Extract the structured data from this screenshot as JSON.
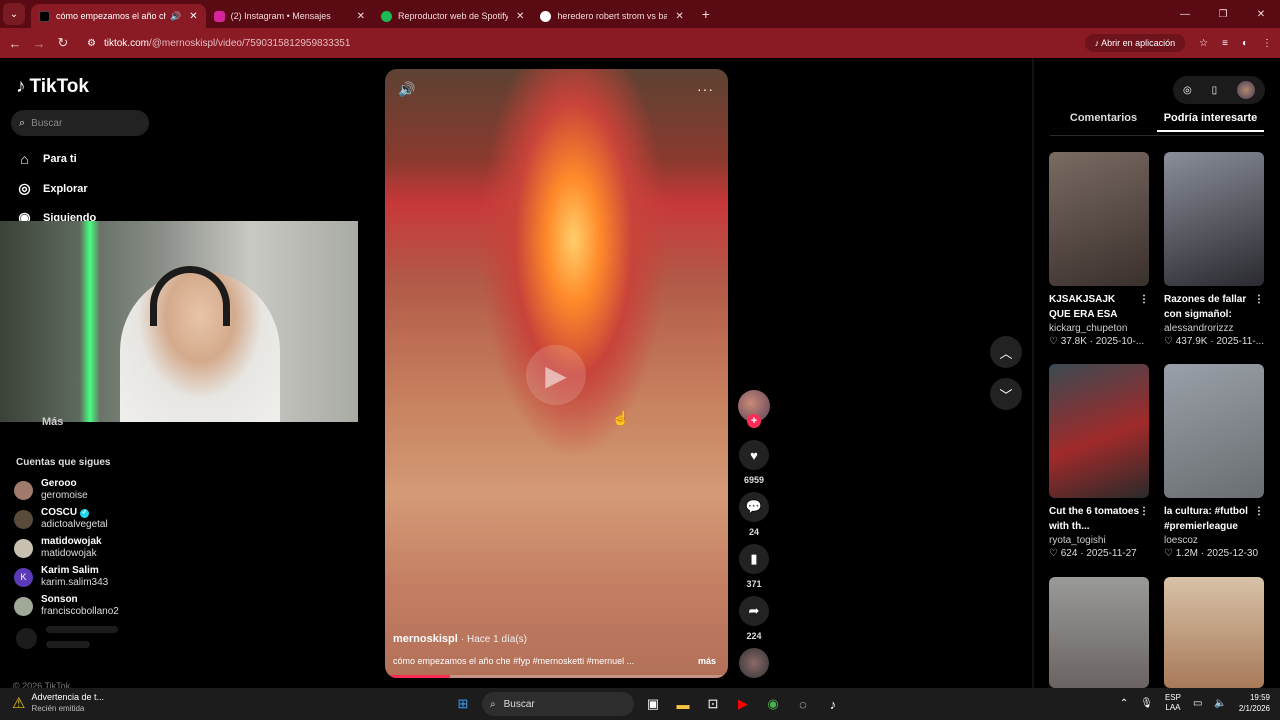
{
  "browser": {
    "tabs": [
      {
        "title": "cómo empezamos el año che",
        "color": "#000000"
      },
      {
        "title": "(2) Instagram • Mensajes",
        "color": "#d6249f"
      },
      {
        "title": "Reproductor web de Spotify: m",
        "color": "#1db954"
      },
      {
        "title": "heredero robert strom vs baule",
        "color": "#4285f4"
      }
    ],
    "url_domain": "tiktok.com",
    "url_path": "/@mernoskispl/video/7590315812959833351",
    "open_in_app": "Abrir en aplicación"
  },
  "sidebar": {
    "logo": "TikTok",
    "search_placeholder": "Buscar",
    "nav": [
      {
        "label": "Para ti",
        "icon": "home-icon"
      },
      {
        "label": "Explorar",
        "icon": "compass-icon"
      },
      {
        "label": "Siguiendo",
        "icon": "following-icon"
      }
    ],
    "more_label": "Más",
    "following_title": "Cuentas que sigues",
    "following": [
      {
        "name": "Gerooo",
        "handle": "geromoise",
        "verified": false,
        "initial": ""
      },
      {
        "name": "COSCU",
        "handle": "adictoalvegetal",
        "verified": true,
        "initial": ""
      },
      {
        "name": "matidowojak",
        "handle": "matidowojak",
        "verified": false,
        "initial": ""
      },
      {
        "name": "Karim Salim",
        "handle": "karim.salim343",
        "verified": false,
        "initial": "K"
      },
      {
        "name": "Sonson",
        "handle": "franciscobollano2",
        "verified": false,
        "initial": ""
      }
    ],
    "copyright": "© 2026 TikTok"
  },
  "video": {
    "author": "mernoskispl",
    "time": "· Hace 1 día(s)",
    "caption": "cómo empezamos el año che #fyp #mernosketti #mernuel ...",
    "more": "más",
    "progress": 0.19,
    "likes": "6959",
    "comments": "24",
    "saves": "371",
    "shares": "224"
  },
  "right_panel": {
    "tabs": [
      {
        "label": "Comentarios",
        "active": false
      },
      {
        "label": "Podría interesarte",
        "active": true
      }
    ],
    "cards": [
      {
        "title": "KJSAKJSAJK QUE ERA ESA LEEETR...",
        "user": "kickarg_chupeton",
        "likes": "37.8K",
        "date": "2025-10-...",
        "thumb": "#6a5a52"
      },
      {
        "title": "Razones de fallar con sigmañol:",
        "user": "alessandrorizzz",
        "likes": "437.9K",
        "date": "2025-11-...",
        "thumb": "#4a4a52"
      },
      {
        "title": "Cut the 6 tomatoes with th...",
        "user": "ryota_togishi",
        "likes": "624",
        "date": "2025-11-27",
        "thumb": "#5a3a3a"
      },
      {
        "title": "la cultura: #futbol #premierleague",
        "user": "loescoz",
        "likes": "1.2M",
        "date": "2025-12-30",
        "thumb": "#6a7078"
      },
      {
        "title": "",
        "user": "",
        "likes": "",
        "date": "",
        "thumb": "#8a8a88"
      },
      {
        "title": "",
        "user": "",
        "likes": "",
        "date": "",
        "thumb": "#b89a82"
      }
    ]
  },
  "taskbar": {
    "notification_title": "Advertencia de t...",
    "notification_sub": "Recién emitida",
    "search_placeholder": "Buscar",
    "lang1": "ESP",
    "lang2": "LAA",
    "time": "19:59",
    "date": "2/1/2026"
  }
}
